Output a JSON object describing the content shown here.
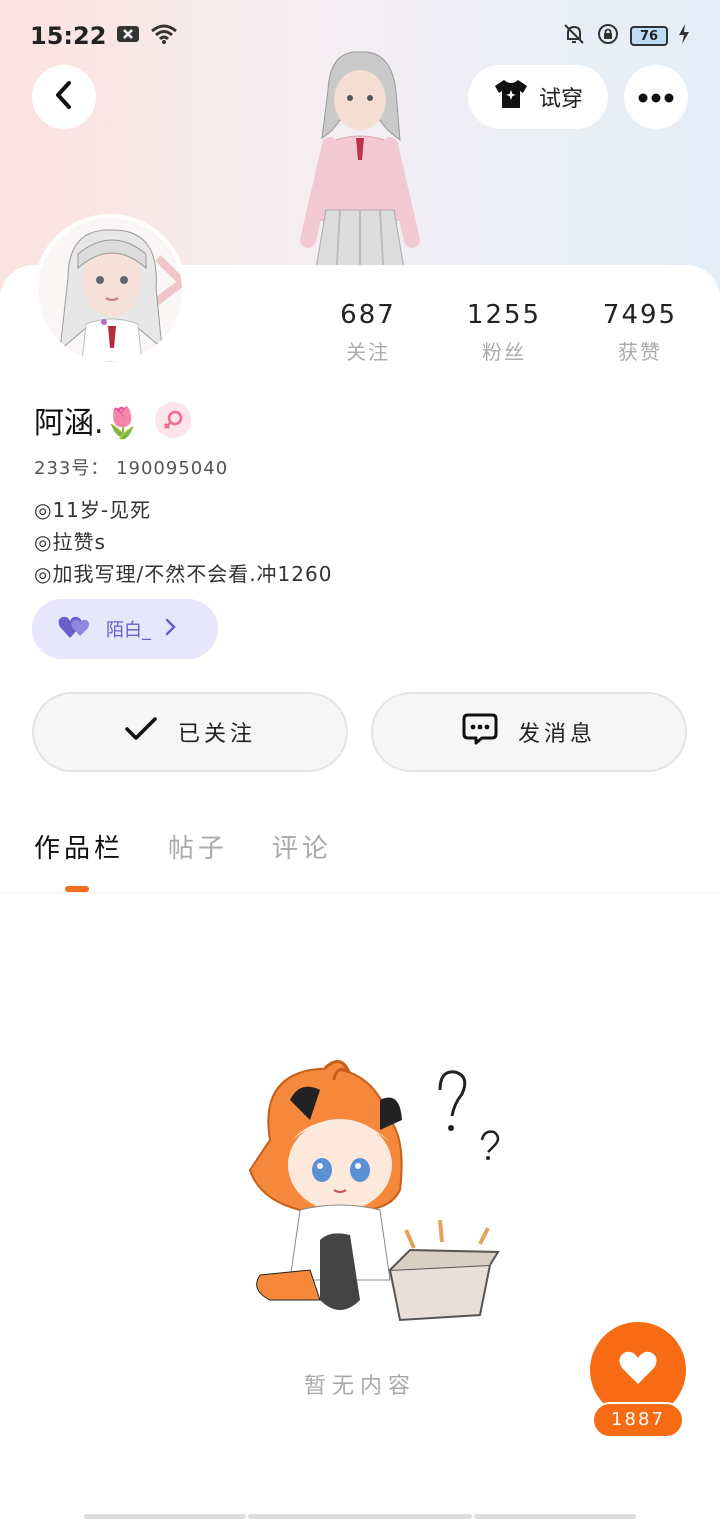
{
  "status_bar": {
    "time": "15:22",
    "battery": "76"
  },
  "header": {
    "tryon_label": "试穿"
  },
  "profile": {
    "stats": [
      {
        "value": "687",
        "label": "关注"
      },
      {
        "value": "1255",
        "label": "粉丝"
      },
      {
        "value": "7495",
        "label": "获赞"
      }
    ],
    "username": "阿涵.🌷",
    "uid": "233号： 190095040",
    "bio": [
      "◎11岁-见死",
      "◎拉赞s",
      "◎加我写理/不然不会看.冲1260"
    ],
    "cp_name": "陌白_"
  },
  "actions": {
    "follow_label": "已关注",
    "message_label": "发消息"
  },
  "tabs": [
    "作品栏",
    "帖子",
    "评论"
  ],
  "empty_text": "暂无内容",
  "like_count": "1887",
  "colors": {
    "accent": "#f76b14",
    "cp_purple": "#6a5fc8"
  }
}
